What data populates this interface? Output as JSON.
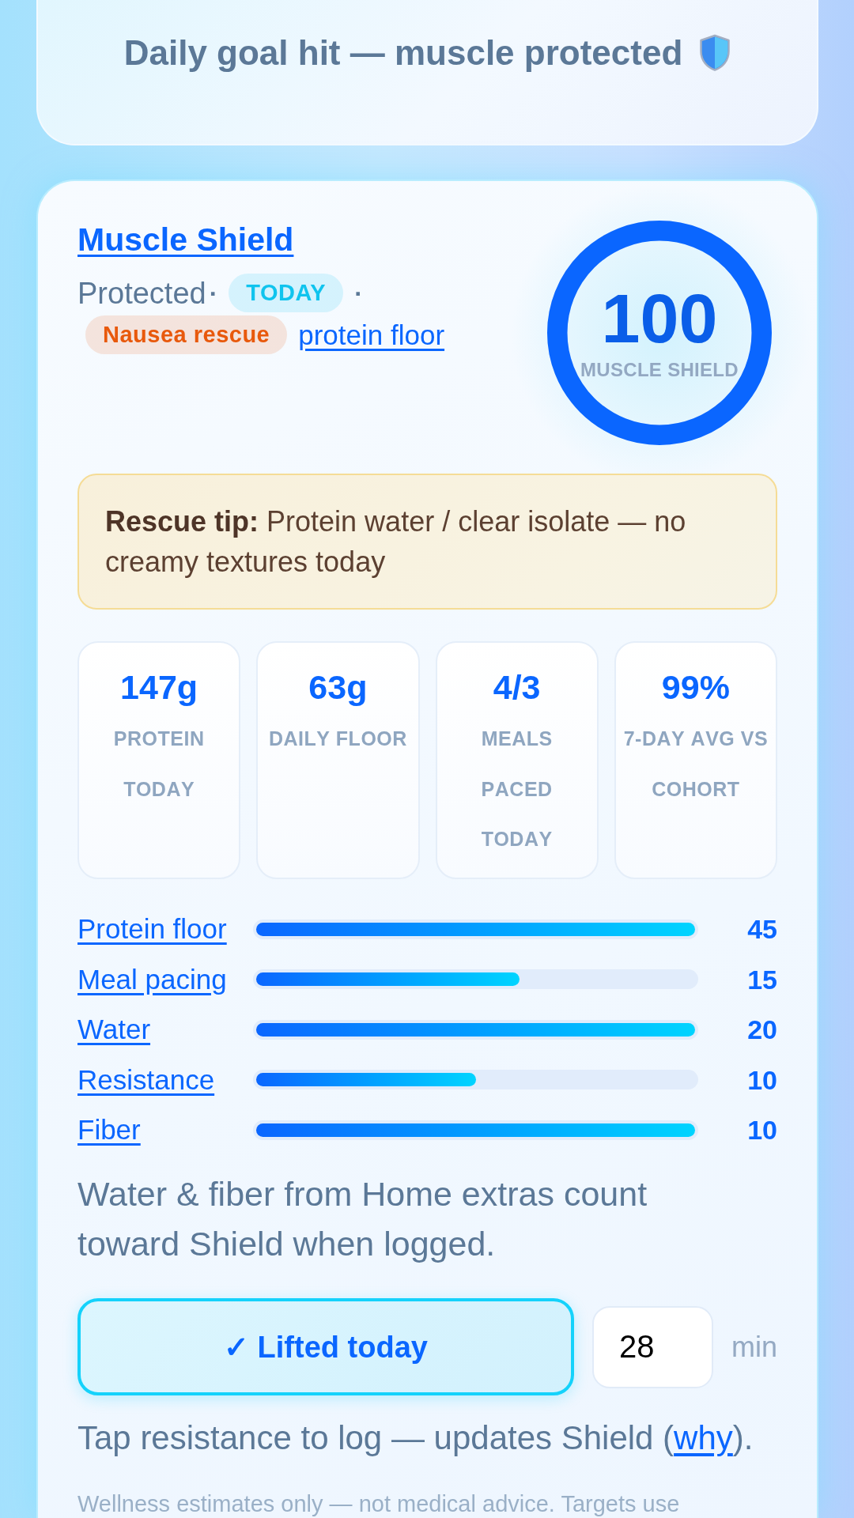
{
  "banner": {
    "text": "Daily goal hit — muscle protected"
  },
  "card": {
    "title": "Muscle Shield",
    "meta": [
      {
        "kind": "text",
        "text": "Protected"
      },
      {
        "kind": "separator",
        "text": "·"
      },
      {
        "kind": "tag",
        "text": "TODAY",
        "color": "#10c4ee"
      },
      {
        "kind": "separator",
        "text": "·"
      },
      {
        "kind": "tag",
        "text": "Nausea rescue",
        "color": "#e8590c"
      },
      {
        "kind": "link",
        "text": "protein floor"
      }
    ],
    "score": {
      "value": "100",
      "label": "MUSCLE SHIELD",
      "level": 1
    },
    "tip": {
      "text": "**Rescue tip:** Protein water / clear isolate — no creamy textures today"
    },
    "stats": [
      {
        "value": "147g",
        "label": "PROTEIN TODAY"
      },
      {
        "value": "63g",
        "label": "DAILY FLOOR"
      },
      {
        "value": "4/3",
        "label": "MEALS PACED TODAY"
      },
      {
        "value": "99%",
        "label": "7-DAY AVG VS COHORT"
      }
    ],
    "bars": [
      {
        "label": "Protein floor",
        "level": 1,
        "value": "45"
      },
      {
        "label": "Meal pacing",
        "level": 0.6,
        "value": "15"
      },
      {
        "label": "Water",
        "level": 1,
        "value": "20"
      },
      {
        "label": "Resistance",
        "level": 0.5,
        "value": "10"
      },
      {
        "label": "Fiber",
        "level": 1,
        "value": "10"
      }
    ],
    "note": "Water & fiber from Home extras count toward Shield when logged.",
    "lift": {
      "button": {
        "label": "✓ Lifted today",
        "on": true
      },
      "minutes": {
        "value": "28"
      },
      "unit": "min"
    },
    "hint": {
      "before": "Tap resistance to log — updates Shield (",
      "link": "why",
      "after": ")."
    },
    "footer": "Wellness estimates only — not medical advice. Targets use"
  }
}
